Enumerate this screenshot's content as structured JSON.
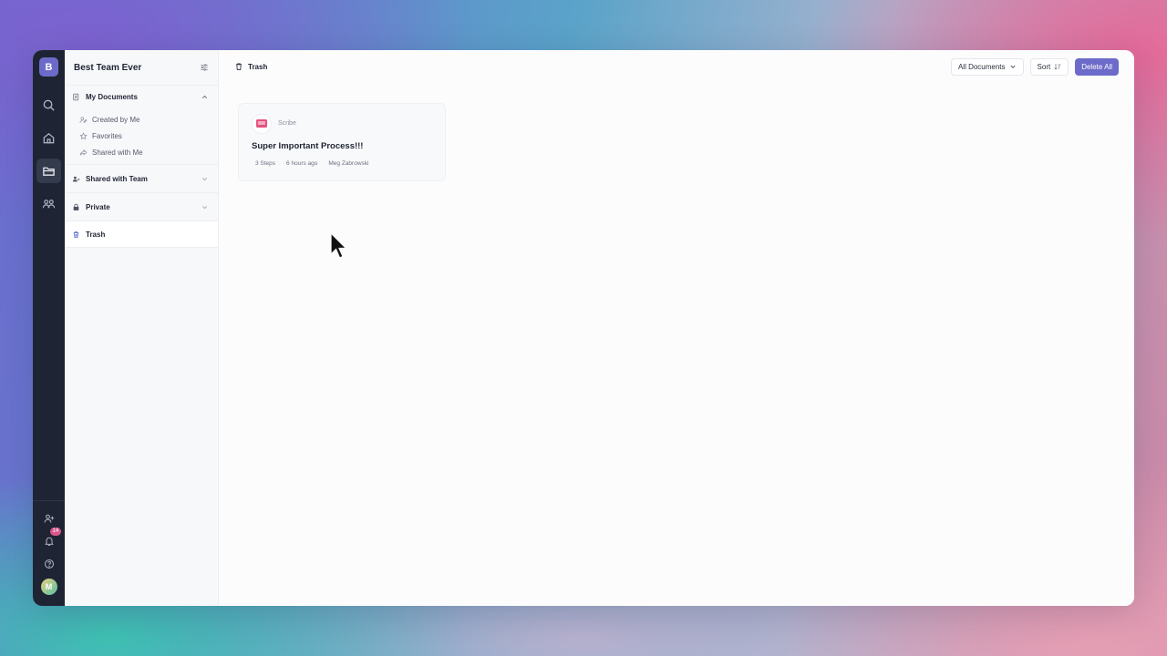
{
  "rail": {
    "workspace_initial": "B",
    "notification_count": "14",
    "user_initial": "M",
    "icons": [
      "search-icon",
      "home-icon",
      "folder-icon",
      "team-icon",
      "add-user-icon",
      "bell-icon",
      "help-icon"
    ]
  },
  "sidebar": {
    "title": "Best Team Ever",
    "my_documents": {
      "label": "My Documents",
      "items": [
        {
          "label": "Created by Me",
          "icon": "user-edit-icon"
        },
        {
          "label": "Favorites",
          "icon": "star-icon"
        },
        {
          "label": "Shared with Me",
          "icon": "share-icon"
        }
      ]
    },
    "shared_with_team": "Shared with Team",
    "private": "Private",
    "trash": "Trash"
  },
  "topbar": {
    "breadcrumb": "Trash",
    "filter_label": "All Documents",
    "sort_label": "Sort",
    "delete_all_label": "Delete All"
  },
  "documents": [
    {
      "source": "Scribe",
      "title": "Super Important Process!!!",
      "steps": "3 Steps",
      "time": "6 hours ago",
      "author": "Meg Zabrowski"
    }
  ],
  "colors": {
    "accent": "#6d6bc9",
    "rail": "#1e2433",
    "badge": "#d9578a"
  }
}
